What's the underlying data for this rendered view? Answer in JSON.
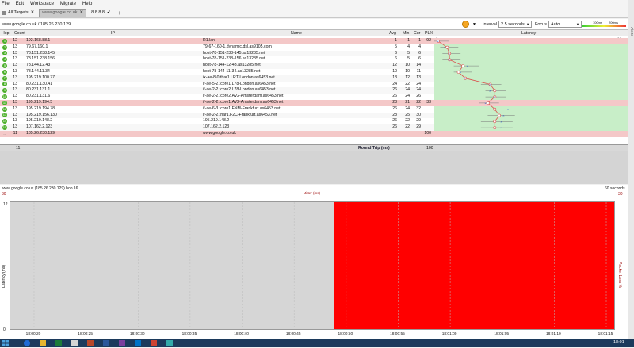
{
  "menu": [
    "File",
    "Edit",
    "Workspace",
    "Migrate",
    "Help"
  ],
  "tabs": {
    "all_targets": "All Targets",
    "target_host": "www.google.co.uk",
    "ip_tab": "8.8.8.8",
    "add": "+"
  },
  "side_text": "Alerts",
  "address": {
    "text": "www.google.co.uk / 185.26.230.129"
  },
  "toolbar": {
    "interval_label": "Interval",
    "interval_value": "2.5 seconds",
    "focus_label": "Focus",
    "focus_value": "Auto",
    "legend_100": "100ms",
    "legend_200": "200ms"
  },
  "columns": {
    "hop": "Hop",
    "count": "Count",
    "ip": "IP",
    "name": "Name",
    "avg": "Avg",
    "min": "Min",
    "cur": "Cur",
    "pl": "PL%",
    "latency": "Latency",
    "lat_min": "0 ms",
    "lat_max": "84 ms"
  },
  "hops": [
    {
      "hop": "1",
      "count": "12",
      "ip": "192.168.88.1",
      "name": "R1.lan",
      "avg": "1",
      "min": "1",
      "cur": "1",
      "pl": "92",
      "loss": true
    },
    {
      "hop": "2",
      "count": "13",
      "ip": "79.67.160.1",
      "name": "79-67-160-1.dynamic.dsl.as9105.com",
      "avg": "5",
      "min": "4",
      "cur": "4",
      "pl": "",
      "loss": false
    },
    {
      "hop": "3",
      "count": "13",
      "ip": "78.151.238.145",
      "name": "host-78-151-238-145.as13285.net",
      "avg": "6",
      "min": "5",
      "cur": "6",
      "pl": "",
      "loss": false
    },
    {
      "hop": "4",
      "count": "13",
      "ip": "78.151.238.156",
      "name": "host-78-151-238-156.as13285.net",
      "avg": "6",
      "min": "5",
      "cur": "6",
      "pl": "",
      "loss": false
    },
    {
      "hop": "5",
      "count": "13",
      "ip": "78.144.12.43",
      "name": "host-78-144-12-43.as13285.net",
      "avg": "12",
      "min": "10",
      "cur": "14",
      "pl": "",
      "loss": false
    },
    {
      "hop": "6",
      "count": "13",
      "ip": "78.144.11.34",
      "name": "host-78-144-11-34.as13285.net",
      "avg": "10",
      "min": "10",
      "cur": "11",
      "pl": "",
      "loss": false
    },
    {
      "hop": "7",
      "count": "13",
      "ip": "195.219.100.77",
      "name": "ix-ae-8-0.thar1.LRT-London.as6453.net",
      "avg": "13",
      "min": "12",
      "cur": "13",
      "pl": "",
      "loss": false
    },
    {
      "hop": "8",
      "count": "13",
      "ip": "80.231.130.41",
      "name": "if-ae-5-2.tcore1.L78-London.as6453.net",
      "avg": "24",
      "min": "22",
      "cur": "24",
      "pl": "",
      "loss": false
    },
    {
      "hop": "9",
      "count": "13",
      "ip": "80.231.131.1",
      "name": "if-ae-2-2.tcore2.L78-London.as6453.net",
      "avg": "26",
      "min": "24",
      "cur": "24",
      "pl": "",
      "loss": false
    },
    {
      "hop": "10",
      "count": "13",
      "ip": "80.231.131.6",
      "name": "if-ae-2-2.tcore2.AV2-Amsterdam.as6453.net",
      "avg": "26",
      "min": "24",
      "cur": "26",
      "pl": "",
      "loss": false
    },
    {
      "hop": "11",
      "count": "13",
      "ip": "195.219.194.5",
      "name": "if-ae-2-2.tcore1.AV2-Amsterdam.as6453.net",
      "avg": "23",
      "min": "21",
      "cur": "22",
      "pl": "33",
      "loss": true
    },
    {
      "hop": "12",
      "count": "13",
      "ip": "195.219.194.78",
      "name": "if-ae-6-3.tcore1.FNM-Frankfurt.as6453.net",
      "avg": "26",
      "min": "24",
      "cur": "32",
      "pl": "",
      "loss": false
    },
    {
      "hop": "13",
      "count": "13",
      "ip": "195.219.156.130",
      "name": "if-ae-2-2.thar1.F2C-Frankfurt.as6453.net",
      "avg": "28",
      "min": "25",
      "cur": "30",
      "pl": "",
      "loss": false
    },
    {
      "hop": "14",
      "count": "13",
      "ip": "195.219.148.2",
      "name": "195.219.148.2",
      "avg": "26",
      "min": "22",
      "cur": "29",
      "pl": "",
      "loss": false
    },
    {
      "hop": "15",
      "count": "13",
      "ip": "107.162.2.123",
      "name": "107.162.2.123",
      "avg": "26",
      "min": "22",
      "cur": "29",
      "pl": "",
      "loss": false
    },
    {
      "hop": "...",
      "count": "11",
      "ip": "185.26.230.129",
      "name": "www.google.co.uk",
      "avg": "",
      "min": "",
      "cur": "",
      "pl": "100",
      "loss": true
    }
  ],
  "summary": {
    "count": "11",
    "label": "Round Trip (ms)",
    "pl": "100"
  },
  "history": {
    "title": "www.google.co.uk (185.26.230.129) hop 16",
    "jitter_label": "Jitter (ms)",
    "left_top": "30",
    "right_top": "60 seconds",
    "right_top2": "30",
    "y_top": "12",
    "y_bottom": "0",
    "ylabel": "Latency (ms)",
    "ylabel_right": "Packet Loss %",
    "times": [
      "18:00:20",
      "18:00:25",
      "18:00:30",
      "18:00:35",
      "18:00:40",
      "18:00:45",
      "18:00:50",
      "18:00:55",
      "18:01:00",
      "18:01:05",
      "18:01:10",
      "18:01:15"
    ],
    "loss_start_fraction": 0.537
  },
  "taskbar": {
    "clock": "18:01"
  },
  "colors": {
    "loss_row": "#f4c8c8",
    "ok_bg": "#c8eec8",
    "loss_fill": "#ff0000",
    "taskbar": "#1c3a5c",
    "hop_icon": "#4caf2a",
    "trace_line": "#d9534f"
  }
}
